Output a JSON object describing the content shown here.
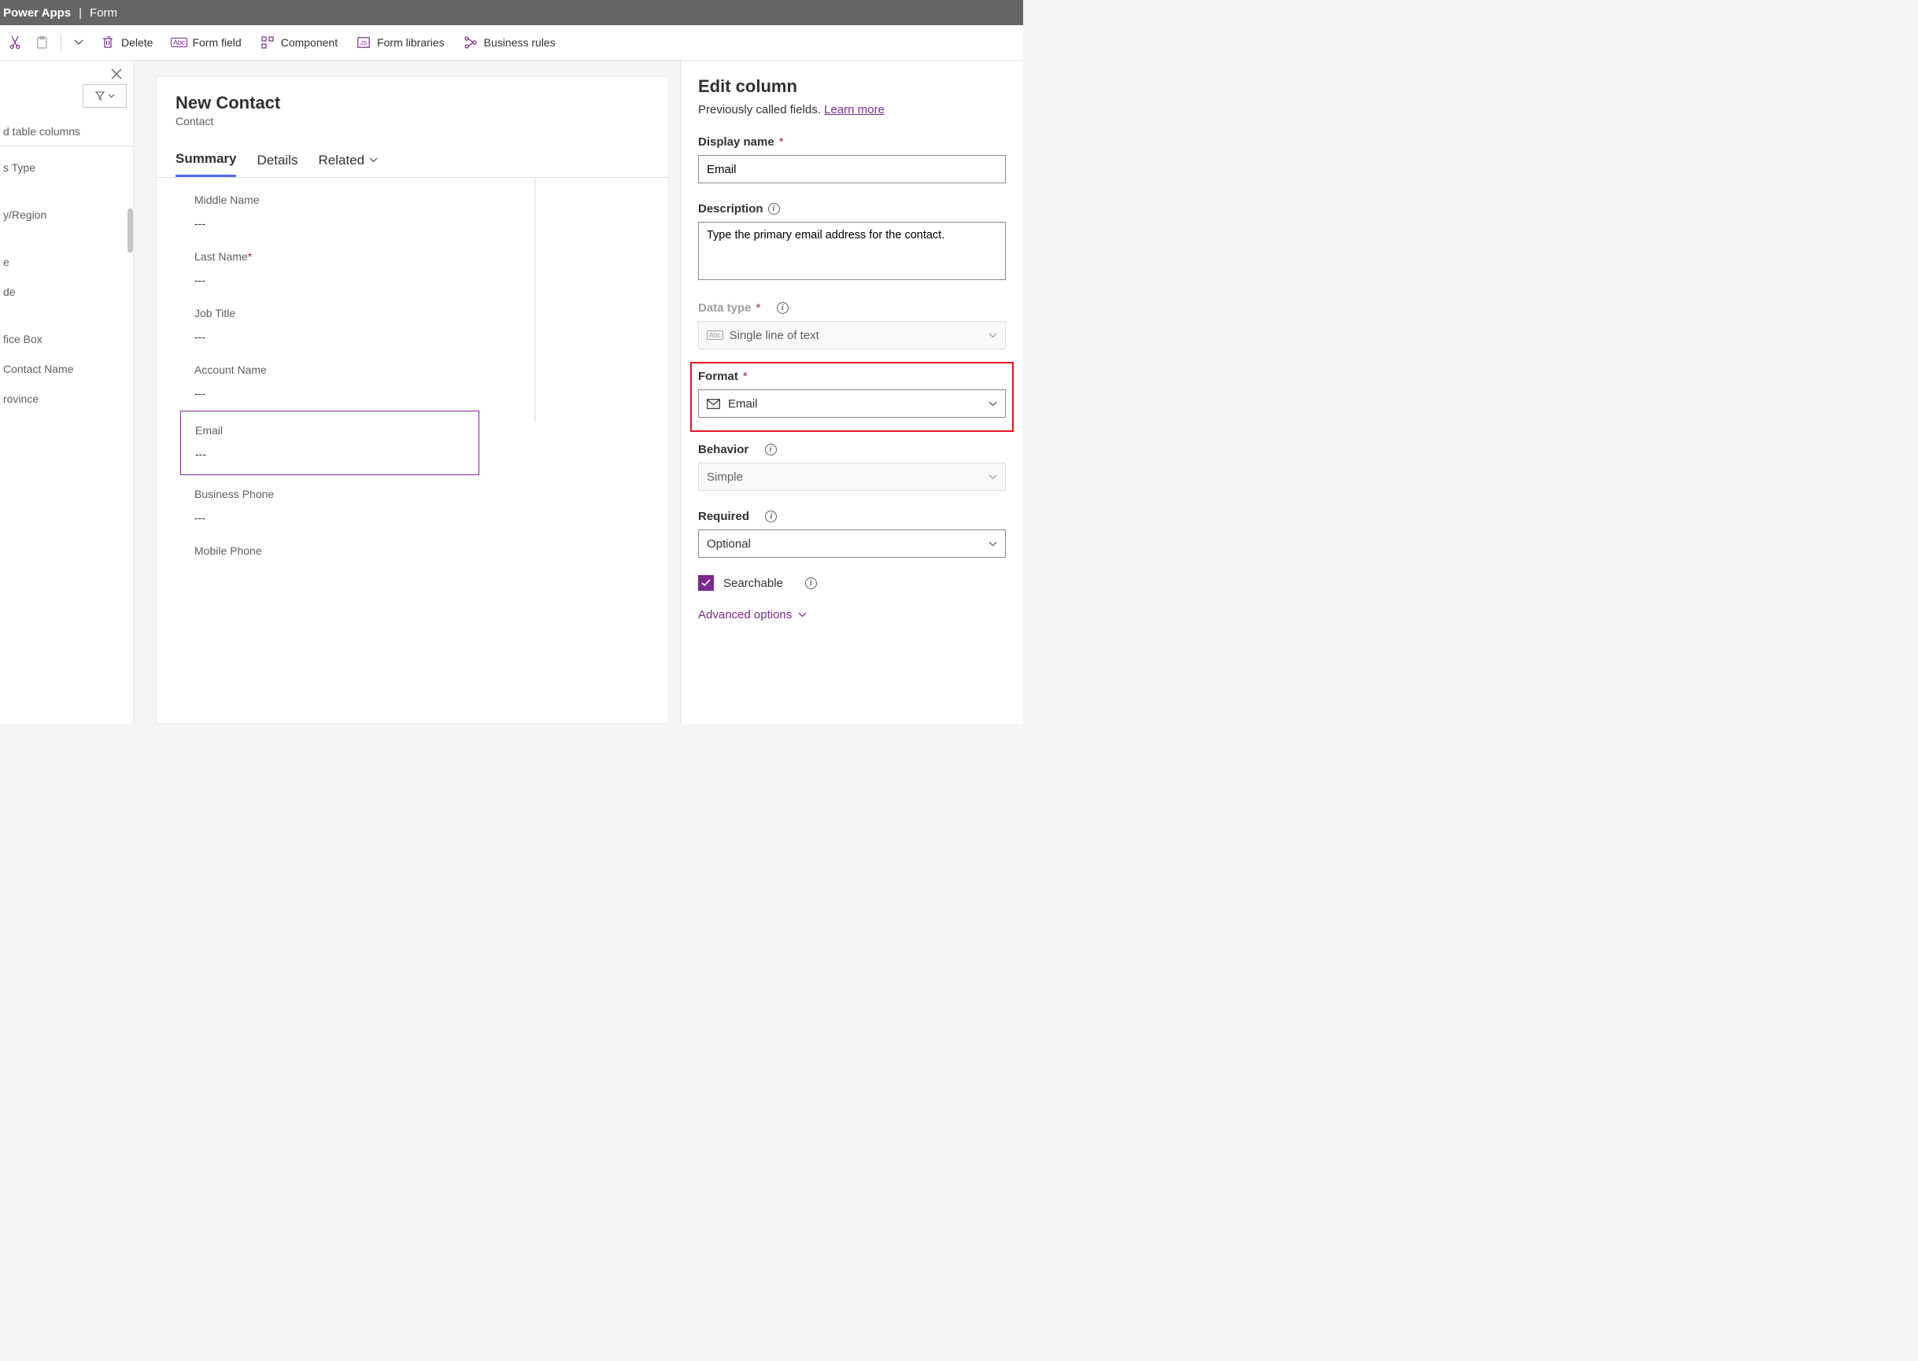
{
  "header": {
    "brand": "Power Apps",
    "page": "Form"
  },
  "toolbar": {
    "delete": "Delete",
    "formField": "Form field",
    "component": "Component",
    "formLibraries": "Form libraries",
    "businessRules": "Business rules"
  },
  "leftPanel": {
    "heading": "d table columns",
    "items": [
      "s Type",
      "",
      "y/Region",
      "",
      "e",
      "de",
      "",
      "fice Box",
      "Contact Name",
      "rovince"
    ]
  },
  "form": {
    "title": "New Contact",
    "entity": "Contact",
    "tabs": [
      "Summary",
      "Details",
      "Related"
    ],
    "fields": [
      {
        "label": "Middle Name",
        "value": "---",
        "required": false
      },
      {
        "label": "Last Name",
        "value": "---",
        "required": true
      },
      {
        "label": "Job Title",
        "value": "---",
        "required": false
      },
      {
        "label": "Account Name",
        "value": "---",
        "required": false
      },
      {
        "label": "Email",
        "value": "---",
        "required": false,
        "selected": true
      },
      {
        "label": "Business Phone",
        "value": "---",
        "required": false
      },
      {
        "label": "Mobile Phone",
        "value": "",
        "required": false
      }
    ]
  },
  "editPanel": {
    "title": "Edit column",
    "subtitlePrefix": "Previously called fields. ",
    "learnMore": "Learn more",
    "displayName": {
      "label": "Display name",
      "value": "Email"
    },
    "description": {
      "label": "Description",
      "value": "Type the primary email address for the contact."
    },
    "dataType": {
      "label": "Data type",
      "value": "Single line of text"
    },
    "format": {
      "label": "Format",
      "value": "Email"
    },
    "behavior": {
      "label": "Behavior",
      "value": "Simple"
    },
    "required": {
      "label": "Required",
      "value": "Optional"
    },
    "searchable": "Searchable",
    "advanced": "Advanced options"
  }
}
